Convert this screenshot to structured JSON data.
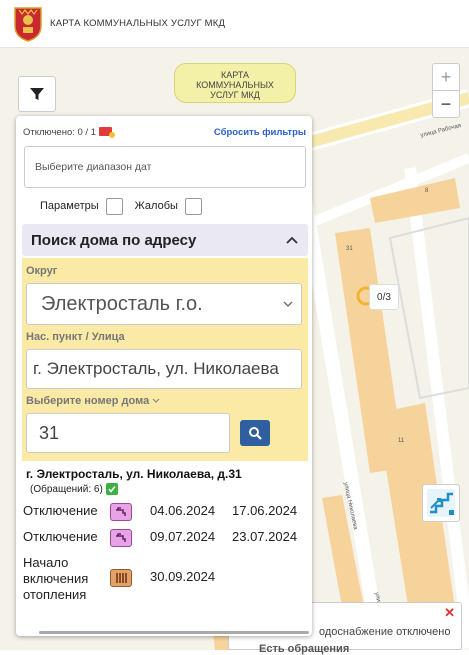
{
  "header": {
    "title": "КАРТА КОММУНАЛЬНЫХ УСЛУГ МКД"
  },
  "map": {
    "label_lines": [
      "КАРТА",
      "КОММУНАЛЬНЫХ",
      "УСЛУГ МКД"
    ],
    "zoom_in": "+",
    "zoom_out": "−",
    "cluster_count": "0/3",
    "building_numbers": [
      "8",
      "31",
      "11"
    ],
    "streets": [
      "улица Рабочая",
      "улица Николаева",
      "улица Николаева"
    ]
  },
  "filter_panel": {
    "disabled_text": "Отключено: 0 / 1",
    "reset_label": "Сбросить фильтры",
    "date_placeholder": "Выберите диапазон дат",
    "params_label": "Параметры",
    "complaints_label": "Жалобы",
    "search_title": "Поиск дома по адресу",
    "district_label": "Округ",
    "district_value": "Электросталь г.о.",
    "locality_label": "Нас. пункт / Улица",
    "locality_value": "г. Электросталь, ул. Николаева",
    "house_label": "Выберите номер дома",
    "house_value": "31",
    "result_address": "г. Электросталь, ул. Николаева, д.31",
    "result_count": "(Обращений: 6)",
    "events": [
      {
        "type": "Отключение",
        "from": "04.06.2024",
        "to": "17.06.2024",
        "icon": "hot-water-tap-icon",
        "color": "#e6a3e6"
      },
      {
        "type": "Отключение",
        "from": "09.07.2024",
        "to": "23.07.2024",
        "icon": "hot-water-tap-icon",
        "color": "#e6a3e6"
      },
      {
        "type": "Начало включения отопления",
        "from": "30.09.2024",
        "to": "",
        "icon": "radiator-icon",
        "color": "#e3a06a"
      }
    ]
  },
  "popup": {
    "close": "✕",
    "text": "одоснабжение отключено",
    "text2": "Есть обращения"
  },
  "colors": {
    "accent_blue": "#2f5f9e",
    "link_blue": "#2a60c8",
    "yellow_bg": "#fbeaa6",
    "map_bg": "#f5f2ea",
    "building": "#f6d39a"
  }
}
